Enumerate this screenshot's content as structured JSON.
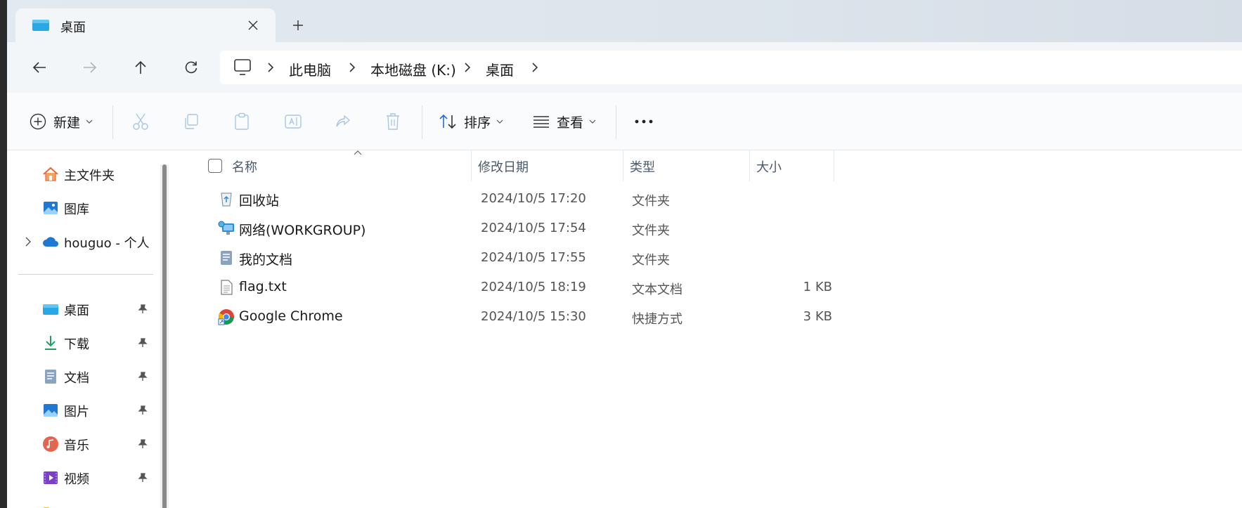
{
  "window": {
    "tab_title": "桌面"
  },
  "colors": {
    "accent": "#1f6fd1",
    "folder_desktop": "#2aa8e6",
    "window_bg": "#ffffff"
  },
  "breadcrumb": {
    "items": [
      "此电脑",
      "本地磁盘 (K:)",
      "桌面"
    ]
  },
  "toolbar": {
    "new_label": "新建",
    "sort_label": "排序",
    "view_label": "查看"
  },
  "sidebar": {
    "top_items": [
      {
        "label": "主文件夹",
        "icon": "home-icon"
      },
      {
        "label": "图库",
        "icon": "gallery-icon"
      },
      {
        "label": "houguo - 个人",
        "icon": "onedrive-icon"
      }
    ],
    "pinned_items": [
      {
        "label": "桌面",
        "icon": "desktop-folder-icon"
      },
      {
        "label": "下载",
        "icon": "download-icon"
      },
      {
        "label": "文档",
        "icon": "documents-icon"
      },
      {
        "label": "图片",
        "icon": "pictures-icon"
      },
      {
        "label": "音乐",
        "icon": "music-icon"
      },
      {
        "label": "视频",
        "icon": "video-icon"
      }
    ]
  },
  "columns": {
    "name": "名称",
    "date": "修改日期",
    "type": "类型",
    "size": "大小"
  },
  "files": [
    {
      "name": "回收站",
      "date": "2024/10/5 17:20",
      "type": "文件夹",
      "size": "",
      "icon": "recycle-bin-icon"
    },
    {
      "name": "网络(WORKGROUP)",
      "date": "2024/10/5 17:54",
      "type": "文件夹",
      "size": "",
      "icon": "network-icon"
    },
    {
      "name": "我的文档",
      "date": "2024/10/5 17:55",
      "type": "文件夹",
      "size": "",
      "icon": "documents-icon"
    },
    {
      "name": "flag.txt",
      "date": "2024/10/5 18:19",
      "type": "文本文档",
      "size": "1 KB",
      "icon": "text-file-icon"
    },
    {
      "name": "Google Chrome",
      "date": "2024/10/5 15:30",
      "type": "快捷方式",
      "size": "3 KB",
      "icon": "chrome-shortcut-icon"
    }
  ]
}
